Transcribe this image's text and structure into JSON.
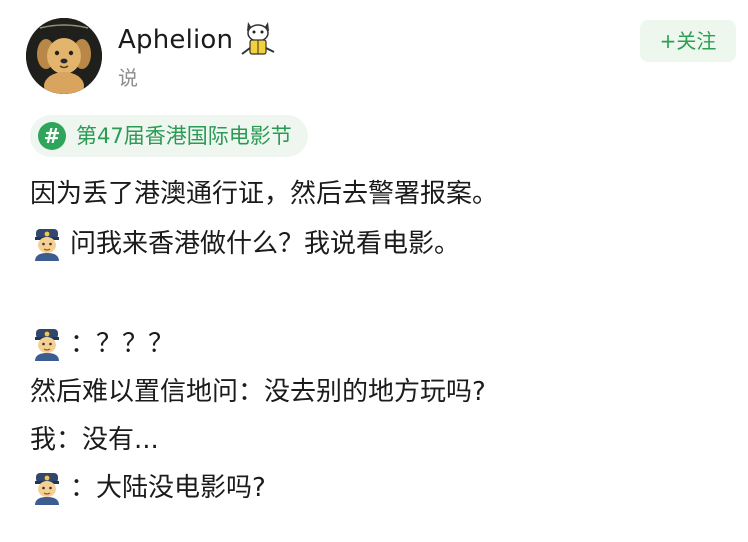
{
  "header": {
    "username": "Aphelion",
    "post_verb": "说",
    "follow_label": "+关注"
  },
  "topic": {
    "label": "第47届香港国际电影节"
  },
  "post": {
    "lines": [
      {
        "officer": false,
        "text": "因为丢了港澳通行证，然后去警署报案。"
      },
      {
        "officer": true,
        "text": "问我来香港做什么？我说看电影。"
      },
      {
        "officer": true,
        "text": "：？？？"
      },
      {
        "officer": false,
        "text": "然后难以置信地问：没去别的地方玩吗?"
      },
      {
        "officer": false,
        "text": "我：没有..."
      },
      {
        "officer": true,
        "text": "：大陆没电影吗?"
      }
    ]
  },
  "colors": {
    "accent_green": "#2fa55c",
    "follow_bg": "#eef7ee",
    "topic_bg": "#eef6ef",
    "meta_gray": "#8e8e8e"
  },
  "icons": {
    "avatar": "cartoon-dog-avatar",
    "badge": "yellow-cat-badge-icon",
    "officer": "police-officer-emoji",
    "topic": "hash-icon"
  }
}
